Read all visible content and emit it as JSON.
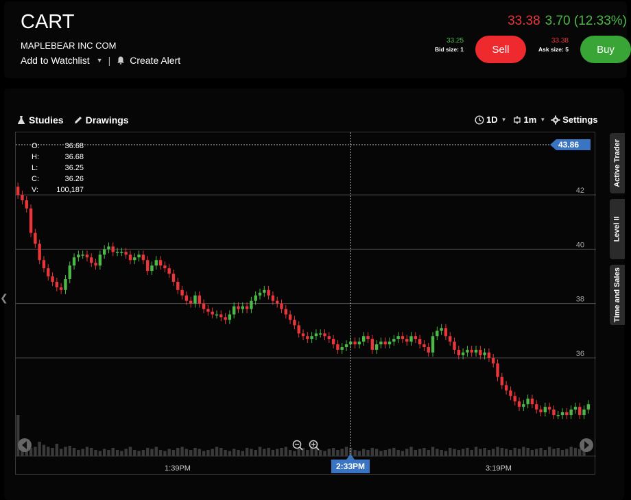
{
  "header": {
    "symbol": "CART",
    "company": "MAPLEBEAR INC COM",
    "watchlist_label": "Add to Watchlist",
    "alert_label": "Create Alert",
    "last_price": "33.38",
    "change": "3.70 (12.33%)",
    "bid_price": "33.25",
    "bid_size": "Bid size: 1",
    "ask_price": "33.38",
    "ask_size": "Ask size: 5",
    "sell_label": "Sell",
    "buy_label": "Buy"
  },
  "toolbar": {
    "studies_label": "Studies",
    "drawings_label": "Drawings",
    "interval": "1D",
    "bar_period": "1m",
    "settings_label": "Settings"
  },
  "side_tabs": [
    "Active Trader",
    "Level II",
    "Time and Sales"
  ],
  "ohlc": {
    "o_label": "O:",
    "o": "36.68",
    "h_label": "H:",
    "h": "36.68",
    "l_label": "L:",
    "l": "36.25",
    "c_label": "C:",
    "c": "36.26",
    "v_label": "V:",
    "v": "100,187"
  },
  "colors": {
    "up": "#4cb848",
    "down": "#e8363a",
    "accent": "#3a75c4"
  },
  "chart_data": {
    "type": "candlestick",
    "y_ticks": [
      "42",
      "40",
      "38",
      "36"
    ],
    "ylim": [
      33.7,
      44.3
    ],
    "x_ticks": [
      "1:39PM",
      "2:33PM",
      "3:19PM"
    ],
    "crosshair_time": "2:33PM",
    "price_marker": "43.86",
    "close_series": [
      42.0,
      41.8,
      41.5,
      40.6,
      40.2,
      39.6,
      39.3,
      39.0,
      38.8,
      38.6,
      38.5,
      38.9,
      39.4,
      39.7,
      39.8,
      39.8,
      39.7,
      39.5,
      39.4,
      39.8,
      40.0,
      40.1,
      39.9,
      39.9,
      39.9,
      39.8,
      39.6,
      39.7,
      39.8,
      39.6,
      39.2,
      39.4,
      39.6,
      39.4,
      39.3,
      39.1,
      38.8,
      38.5,
      38.3,
      38.1,
      38.0,
      38.3,
      38.0,
      37.8,
      37.7,
      37.6,
      37.6,
      37.5,
      37.4,
      37.6,
      37.9,
      37.8,
      37.9,
      37.8,
      38.1,
      38.3,
      38.4,
      38.5,
      38.3,
      38.1,
      38.0,
      37.8,
      37.6,
      37.4,
      37.2,
      36.9,
      36.8,
      36.7,
      36.8,
      36.9,
      36.9,
      36.8,
      36.7,
      36.5,
      36.3,
      36.4,
      36.5,
      36.6,
      36.5,
      36.6,
      36.8,
      36.7,
      36.3,
      36.5,
      36.6,
      36.5,
      36.6,
      36.7,
      36.8,
      36.7,
      36.6,
      36.8,
      36.7,
      36.5,
      36.4,
      36.2,
      36.8,
      37.0,
      37.1,
      36.8,
      36.6,
      36.3,
      36.1,
      36.2,
      36.3,
      36.2,
      36.3,
      36.1,
      36.2,
      36.0,
      35.8,
      35.3,
      35.0,
      34.8,
      34.6,
      34.4,
      34.2,
      34.3,
      34.5,
      34.3,
      34.1,
      34.0,
      34.2,
      34.1,
      33.9,
      33.9,
      34.0,
      33.9,
      34.1,
      34.2,
      33.9,
      34.1,
      34.3
    ],
    "volume_series": [
      40,
      10,
      12,
      8,
      9,
      14,
      11,
      9,
      8,
      12,
      7,
      9,
      10,
      8,
      6,
      7,
      9,
      8,
      6,
      5,
      7,
      6,
      8,
      6,
      5,
      7,
      9,
      6,
      5,
      6,
      8,
      7,
      9,
      6,
      5,
      7,
      6,
      8,
      9,
      7,
      6,
      8,
      7,
      5,
      6,
      7,
      9,
      8,
      6,
      5,
      7,
      6,
      5,
      8,
      7,
      6,
      9,
      7,
      8,
      6,
      7,
      8,
      9,
      6,
      5,
      7,
      8,
      6,
      9,
      7,
      6,
      5,
      7,
      8,
      6,
      7,
      9,
      8,
      6,
      5,
      7,
      6,
      8,
      7,
      5,
      6,
      7,
      8,
      6,
      5,
      7,
      9,
      6,
      7,
      8,
      6,
      9,
      7,
      6,
      5,
      8,
      7,
      6,
      7,
      8,
      6,
      9,
      7,
      8,
      6,
      7,
      9,
      8,
      7,
      6,
      8,
      7,
      9,
      8,
      6,
      7,
      8,
      6,
      9,
      7,
      8,
      6,
      7,
      9,
      8,
      7,
      10
    ]
  }
}
